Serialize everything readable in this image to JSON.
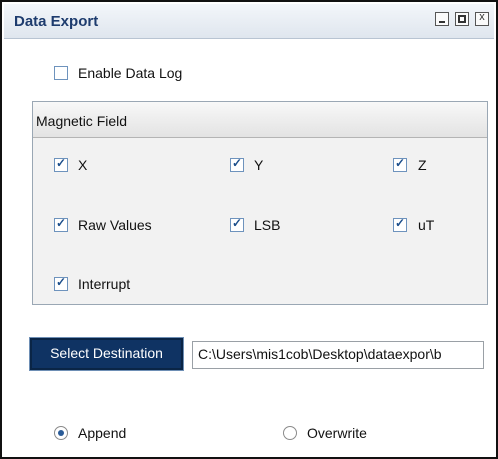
{
  "window": {
    "title": "Data Export",
    "controls": {
      "minimize_glyph": "",
      "maximize_glyph": "",
      "close_glyph": "x"
    }
  },
  "enable_log": {
    "label": "Enable Data Log",
    "checked": false
  },
  "group": {
    "title": "Magnetic Field",
    "checkboxes": [
      {
        "label": "X",
        "checked": true
      },
      {
        "label": "Y",
        "checked": true
      },
      {
        "label": "Z",
        "checked": true
      },
      {
        "label": "Raw Values",
        "checked": true
      },
      {
        "label": "LSB",
        "checked": true
      },
      {
        "label": "uT",
        "checked": true
      },
      {
        "label": "Interrupt",
        "checked": true
      }
    ]
  },
  "destination": {
    "button_label": "Select Destination",
    "path": "C:\\Users\\mis1cob\\Desktop\\dataexpor\\b"
  },
  "mode": {
    "options": [
      {
        "label": "Append",
        "selected": true
      },
      {
        "label": "Overwrite",
        "selected": false
      }
    ]
  }
}
